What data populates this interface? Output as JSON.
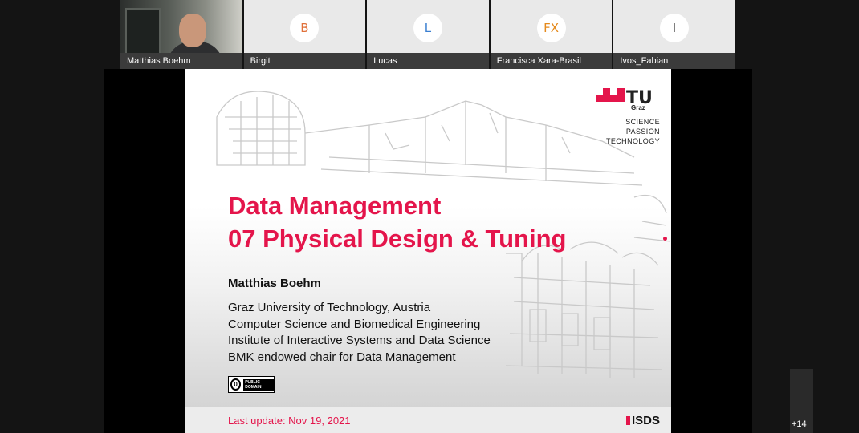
{
  "participants": [
    {
      "name": "Matthias Boehm",
      "initials": "",
      "video": true
    },
    {
      "name": "Birgit",
      "initials": "B",
      "color": "#e0703a"
    },
    {
      "name": "Lucas",
      "initials": "L",
      "color": "#3b7fd1"
    },
    {
      "name": "Francisca Xara-Brasil",
      "initials": "FX",
      "color": "#e58a1c"
    },
    {
      "name": "Ivos_Fabian",
      "initials": "I",
      "color": "#7a7a7a"
    }
  ],
  "slide": {
    "title_line1": "Data Management",
    "title_line2": "07 Physical Design & Tuning",
    "author": "Matthias Boehm",
    "affiliations": [
      "Graz University of Technology, Austria",
      "Computer Science and Biomedical Engineering",
      "Institute of Interactive Systems and Data Science",
      "BMK endowed chair for Data Management"
    ],
    "license_label": "PUBLIC DOMAIN",
    "license_symbol": "0",
    "last_update": "Last update: Nov 19, 2021",
    "logo": {
      "word": "TU",
      "sub": "Graz",
      "tagline": [
        "SCIENCE",
        "PASSION",
        "TECHNOLOGY"
      ]
    },
    "footer_logo": "ISDS",
    "accent_color": "#e4154b"
  },
  "more_participants": "+14"
}
